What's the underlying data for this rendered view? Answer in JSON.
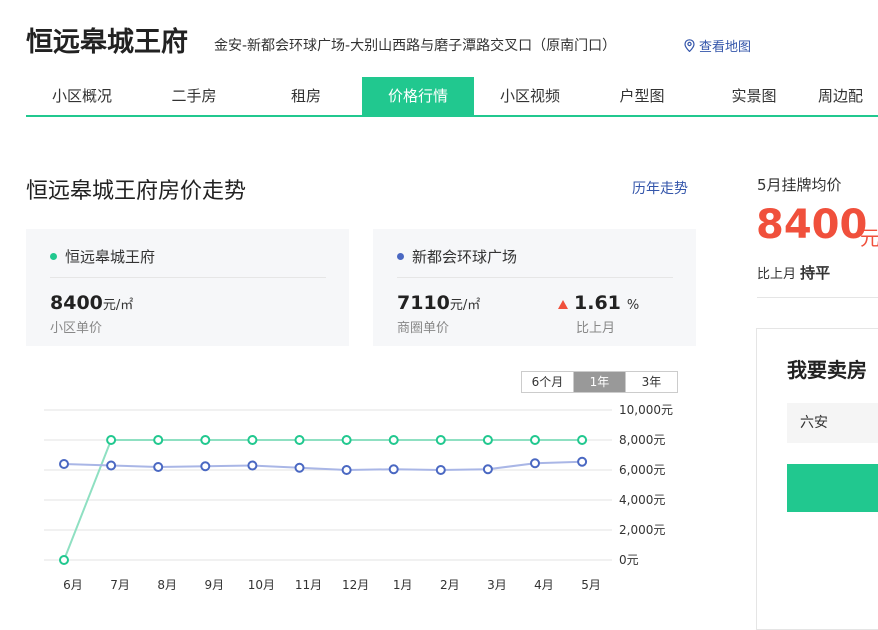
{
  "header": {
    "title": "恒远皋城王府",
    "address": "金安-新都会环球广场-大别山西路与磨子潭路交叉口（原南门口）",
    "map_link": "查看地图"
  },
  "tabs": [
    {
      "label": "小区概况"
    },
    {
      "label": "二手房"
    },
    {
      "label": "租房"
    },
    {
      "label": "价格行情",
      "active": true
    },
    {
      "label": "小区视频"
    },
    {
      "label": "户型图"
    },
    {
      "label": "实景图"
    },
    {
      "label": "周边配"
    }
  ],
  "section": {
    "title": "恒远皋城王府房价走势",
    "history_link": "历年走势"
  },
  "card_community": {
    "name": "恒远皋城王府",
    "price": "8400",
    "unit": "元/㎡",
    "price_label": "小区单价",
    "dot_color": "#21c88f"
  },
  "card_area": {
    "name": "新都会环球广场",
    "price": "7110",
    "unit": "元/㎡",
    "price_label": "商圈单价",
    "change": "1.61",
    "change_unit": "%",
    "change_label": "比上月",
    "dot_color": "#4a68c2",
    "up_color": "#f0503c"
  },
  "range_buttons": [
    {
      "label": "6个月"
    },
    {
      "label": "1年",
      "active": true
    },
    {
      "label": "3年"
    }
  ],
  "chart_data": {
    "type": "line",
    "categories": [
      "6月",
      "7月",
      "8月",
      "9月",
      "10月",
      "11月",
      "12月",
      "1月",
      "2月",
      "3月",
      "4月",
      "5月"
    ],
    "series": [
      {
        "values": [
          0,
          8000,
          8000,
          8000,
          8000,
          8000,
          8000,
          8000,
          8000,
          8000,
          8000,
          8000
        ],
        "color": "#21c88f"
      },
      {
        "values": [
          6400,
          6300,
          6200,
          6250,
          6300,
          6150,
          6000,
          6050,
          6000,
          6050,
          6450,
          6550
        ],
        "color": "#4a68c2"
      }
    ],
    "y_ticks": [
      "10,000元",
      "8,000元",
      "6,000元",
      "4,000元",
      "2,000元",
      "0元"
    ],
    "ylim": [
      0,
      10000
    ],
    "grid": true
  },
  "sidebar": {
    "month_label": "5月挂牌均价",
    "price": "8400",
    "unit": "元",
    "mom_label": "比上月",
    "mom_value": "持平",
    "sell_title": "我要卖房",
    "city": "六安"
  }
}
